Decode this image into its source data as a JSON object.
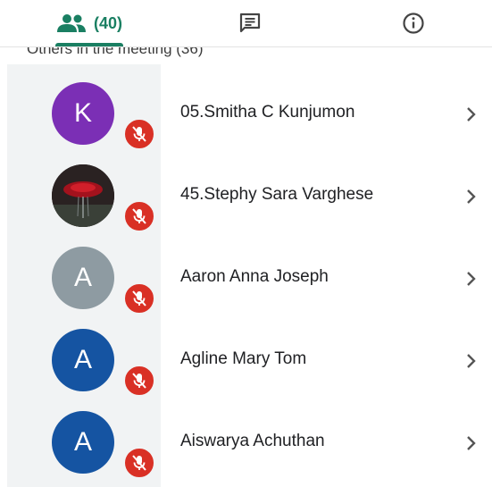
{
  "tabs": {
    "people_count": "(40)",
    "colors": {
      "accent": "#1a7f62",
      "icon": "#444444"
    },
    "icons": {
      "people": "people-icon",
      "chat": "chat-icon",
      "info": "info-icon"
    }
  },
  "section": {
    "title": "Others in the meeting (36)"
  },
  "participants": [
    {
      "name": "05.Smitha C Kunjumon",
      "initial": "K",
      "avatar_color": "#7b2fb5",
      "muted": true
    },
    {
      "name": "45.Stephy Sara Varghese",
      "initial": "",
      "avatar_color": "#2a1e1e",
      "avatar_type": "photo",
      "muted": true
    },
    {
      "name": "Aaron Anna Joseph",
      "initial": "A",
      "avatar_color": "#8e9ba2",
      "muted": true
    },
    {
      "name": "Agline Mary Tom",
      "initial": "A",
      "avatar_color": "#1554a2",
      "muted": true
    },
    {
      "name": "Aiswarya Achuthan",
      "initial": "A",
      "avatar_color": "#1554a2",
      "muted": true
    }
  ],
  "mute_color": "#d93025"
}
